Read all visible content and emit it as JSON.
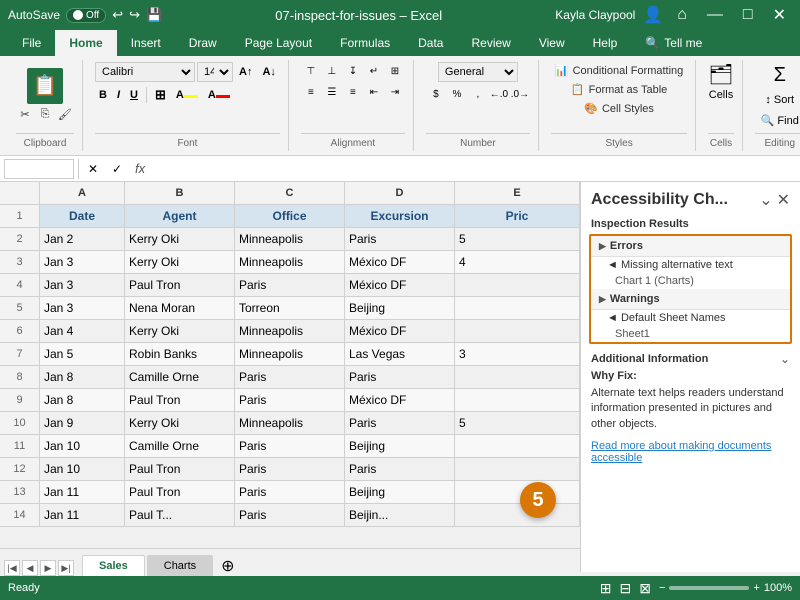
{
  "titleBar": {
    "autosave": "AutoSave",
    "autosave_state": "Off",
    "filename": "07-inspect-for-issues – Excel",
    "user": "Kayla Claypool",
    "minimize": "—",
    "maximize": "□",
    "close": "✕"
  },
  "ribbon": {
    "tabs": [
      "File",
      "Home",
      "Insert",
      "Draw",
      "Page Layout",
      "Formulas",
      "Data",
      "Review",
      "View",
      "Help",
      "Tell me"
    ],
    "active_tab": "Home",
    "clipboard": {
      "label": "Clipboard",
      "paste": "📋"
    },
    "font": {
      "label": "Font",
      "name": "Calibri",
      "size": "14",
      "bold": "B",
      "italic": "I",
      "underline": "U"
    },
    "alignment": {
      "label": "Alignment"
    },
    "number": {
      "label": "Number",
      "format": "General"
    },
    "styles": {
      "label": "Styles",
      "conditional": "Conditional Formatting",
      "format_table": "Format as Table",
      "cell_styles": "Cell Styles"
    },
    "cells": {
      "label": "Cells",
      "text": "Cells"
    },
    "editing": {
      "label": "Editing",
      "text": "Editing"
    }
  },
  "formulaBar": {
    "nameBox": "",
    "formula": ""
  },
  "columns": {
    "headers": [
      "A",
      "B",
      "C",
      "D",
      "E"
    ],
    "widths": [
      85,
      110,
      110,
      110,
      50
    ]
  },
  "rows": [
    {
      "num": 1,
      "cells": [
        "Date",
        "Agent",
        "Office",
        "Excursion",
        "Pric"
      ]
    },
    {
      "num": 2,
      "cells": [
        "Jan 2",
        "Kerry Oki",
        "Minneapolis",
        "Paris",
        "5"
      ]
    },
    {
      "num": 3,
      "cells": [
        "Jan 3",
        "Kerry Oki",
        "Minneapolis",
        "México DF",
        "4"
      ]
    },
    {
      "num": 4,
      "cells": [
        "Jan 3",
        "Paul Tron",
        "Paris",
        "México DF",
        ""
      ]
    },
    {
      "num": 5,
      "cells": [
        "Jan 3",
        "Nena Moran",
        "Torreon",
        "Beijing",
        ""
      ]
    },
    {
      "num": 6,
      "cells": [
        "Jan 4",
        "Kerry Oki",
        "Minneapolis",
        "México DF",
        ""
      ]
    },
    {
      "num": 7,
      "cells": [
        "Jan 5",
        "Robin Banks",
        "Minneapolis",
        "Las Vegas",
        "3"
      ]
    },
    {
      "num": 8,
      "cells": [
        "Jan 8",
        "Camille Orne",
        "Paris",
        "Paris",
        ""
      ]
    },
    {
      "num": 9,
      "cells": [
        "Jan 8",
        "Paul Tron",
        "Paris",
        "México DF",
        ""
      ]
    },
    {
      "num": 10,
      "cells": [
        "Jan 9",
        "Kerry Oki",
        "Minneapolis",
        "Paris",
        "5"
      ]
    },
    {
      "num": 11,
      "cells": [
        "Jan 10",
        "Camille Orne",
        "Paris",
        "Beijing",
        ""
      ]
    },
    {
      "num": 12,
      "cells": [
        "Jan 10",
        "Paul Tron",
        "Paris",
        "Paris",
        ""
      ]
    },
    {
      "num": 13,
      "cells": [
        "Jan 11",
        "Paul Tron",
        "Paris",
        "Beijing",
        ""
      ]
    },
    {
      "num": 14,
      "cells": [
        "Jan 11",
        "Paul T...",
        "Paris",
        "Beijin...",
        ""
      ]
    }
  ],
  "accessibilityPanel": {
    "title": "Accessibility Ch...",
    "inspection_results_label": "Inspection Results",
    "errors_label": "Errors",
    "error_items": [
      "◄ Missing alternative text",
      "Chart 1 (Charts)"
    ],
    "warnings_label": "Warnings",
    "warning_items": [
      "◄ Default Sheet Names",
      "Sheet1"
    ],
    "additional_info_label": "Additional Information",
    "why_fix_label": "Why Fix:",
    "why_fix_text": "Alternate text helps readers understand information presented in pictures and other objects.",
    "read_more_text": "Read more about making documents accessible"
  },
  "sheetTabs": {
    "tabs": [
      "Sales",
      "Charts"
    ],
    "active": "Sales"
  },
  "statusBar": {
    "ready": "Ready",
    "zoom": "100%"
  },
  "stepBadge": {
    "number": "5"
  }
}
